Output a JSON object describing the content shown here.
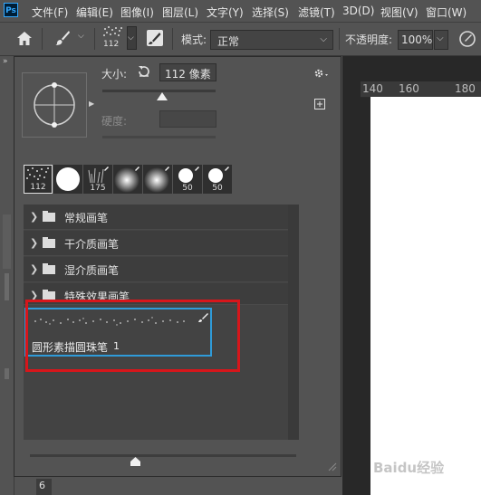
{
  "app_logo": "Ps",
  "menus": [
    "文件(F)",
    "编辑(E)",
    "图像(I)",
    "图层(L)",
    "文字(Y)",
    "选择(S)",
    "滤镜(T)",
    "3D(D)",
    "视图(V)",
    "窗口(W)"
  ],
  "options_bar": {
    "brush_size_label": "112",
    "mode_label": "模式:",
    "mode_value": "正常",
    "opacity_label": "不透明度:",
    "opacity_value": "100%"
  },
  "ruler": {
    "labels": [
      "140",
      "160",
      "180"
    ]
  },
  "panel": {
    "size_label": "大小:",
    "size_value": "112 像素",
    "hardness_label": "硬度:",
    "recent_brushes": [
      {
        "label": "112",
        "kind": "scatter"
      },
      {
        "label": "",
        "kind": "hard-round"
      },
      {
        "label": "175",
        "kind": "grass"
      },
      {
        "label": "",
        "kind": "soft-round"
      },
      {
        "label": "",
        "kind": "soft-round"
      },
      {
        "label": "50",
        "kind": "hard-round-small"
      },
      {
        "label": "50",
        "kind": "hard-round-small"
      }
    ],
    "groups": [
      "常规画笔",
      "干介质画笔",
      "湿介质画笔",
      "特殊效果画笔"
    ],
    "selected_brush": {
      "name": "圆形素描圆珠笔",
      "count": "1"
    }
  },
  "left_tools": {
    "number": "6"
  },
  "watermark": "Baidu经验"
}
